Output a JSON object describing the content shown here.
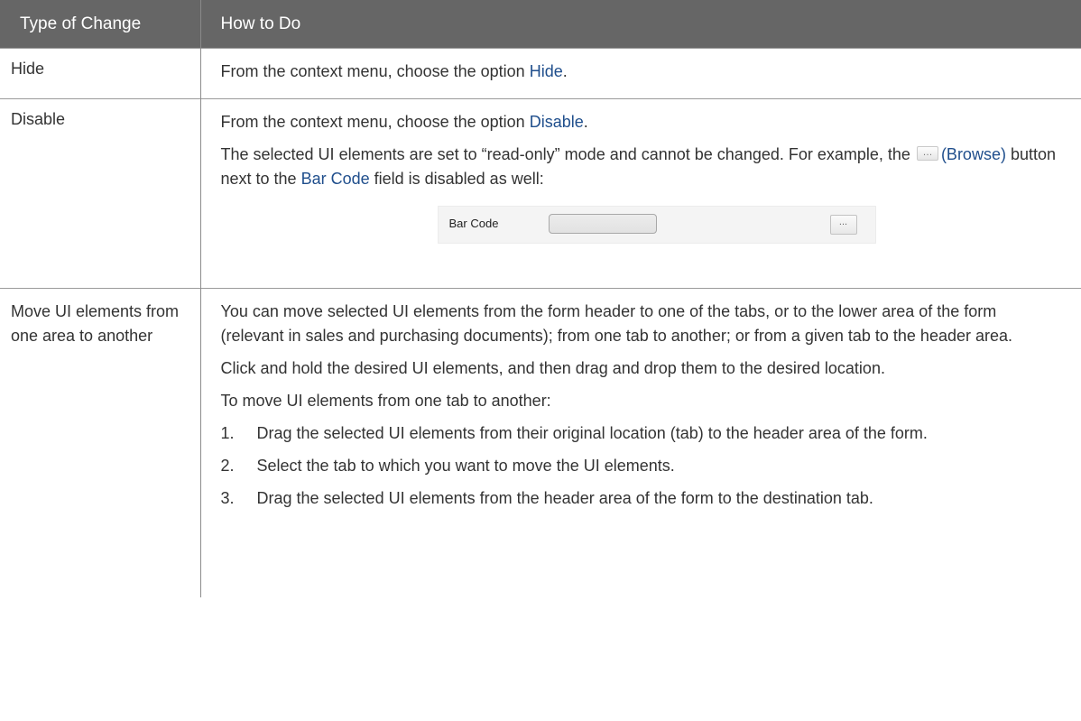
{
  "table": {
    "headers": [
      "Type of Change",
      "How to Do"
    ],
    "hide": {
      "type": "Hide",
      "prefix": "From the context menu, choose the option ",
      "link": "Hide",
      "suffix": "."
    },
    "disable": {
      "type": "Disable",
      "line1_prefix": "From the context menu, choose the option ",
      "line1_link": "Disable",
      "line1_suffix": ".",
      "line2_a": "The selected UI elements are set to “read-only” mode and cannot be changed. For example, the ",
      "line2_browse_link": "(Browse)",
      "line2_b": " button next to the ",
      "line2_field_link": "Bar Code",
      "line2_c": " field is disabled as well:",
      "sample_label": "Bar Code",
      "sample_button": "..."
    },
    "move": {
      "type": "Move UI elements from one area to another",
      "para1": "You can move selected UI elements from the form header to one of the tabs, or to the lower area of the form (relevant in sales and purchasing documents); from one tab to another; or from a given tab to the header area.",
      "para2": "Click and hold the desired UI elements, and then drag and drop them to the desired location.",
      "para3": "To move UI elements from one tab to another:",
      "steps": [
        {
          "num": "1.",
          "text": "Drag the selected UI elements from their original location (tab) to the header area of the form."
        },
        {
          "num": "2.",
          "text": "Select the tab to which you want to move the UI elements."
        },
        {
          "num": "3.",
          "text": "Drag the selected UI elements from the header area of the form to the destination tab."
        }
      ]
    }
  },
  "colors": {
    "header_bg": "#666666",
    "link": "#1f4e8c",
    "text": "#333333"
  },
  "icons": [
    "browse-icon"
  ]
}
